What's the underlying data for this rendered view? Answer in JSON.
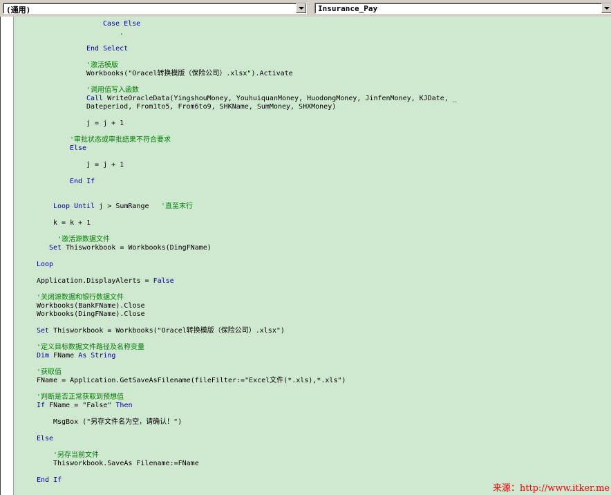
{
  "toolbar": {
    "object_combo": "(通用)",
    "procedure_combo": "Insurance_Pay"
  },
  "code_lines": [
    {
      "text": "Case Else",
      "kind": "keyword"
    },
    {
      "text": "'",
      "kind": "comment"
    },
    {
      "text": "End Select",
      "kind": "keyword"
    },
    {
      "text": "'激活模版",
      "kind": "comment"
    },
    {
      "text": "Workbooks(\"Oracel转换模版（保险公司）.xlsx\").Activate",
      "kind": "plain"
    },
    {
      "text": "'调用值写入函数",
      "kind": "comment"
    },
    {
      "text": "Call WriteOracleData(YingshouMoney, YouhuiquanMoney, HuodongMoney, JinfenMoney, KJDate, _",
      "kind": "call"
    },
    {
      "text": "Dateperiod, From1to5, From6to9, SHKName, SumMoney, SHXMoney)",
      "kind": "plain"
    },
    {
      "text": "j = j + 1",
      "kind": "plain"
    },
    {
      "text": "'审批状态或审批结果不符合要求",
      "kind": "comment"
    },
    {
      "text": "Else",
      "kind": "keyword"
    },
    {
      "text": "j = j + 1",
      "kind": "plain"
    },
    {
      "text": "End If",
      "kind": "keyword"
    },
    {
      "text": "Loop Until j > SumRange",
      "kind": "loop_until"
    },
    {
      "text": "'直至末行",
      "kind": "comment"
    },
    {
      "text": "k = k + 1",
      "kind": "plain"
    },
    {
      "text": "'激活源数据文件",
      "kind": "comment"
    },
    {
      "text": "Set Thisworkbook = Workbooks(DingFName)",
      "kind": "set"
    },
    {
      "text": "Loop",
      "kind": "keyword"
    },
    {
      "text": "Application.DisplayAlerts = False",
      "kind": "false"
    },
    {
      "text": "'关闭源数据和银行数据文件",
      "kind": "comment"
    },
    {
      "text": "Workbooks(BankFName).Close",
      "kind": "plain"
    },
    {
      "text": "Workbooks(DingFName).Close",
      "kind": "plain"
    },
    {
      "text": "Set Thisworkbook = Workbooks(\"Oracel转换模版（保险公司）.xlsx\")",
      "kind": "set"
    },
    {
      "text": "'定义目标数据文件路径及名称变量",
      "kind": "comment"
    },
    {
      "text": "Dim FName As String",
      "kind": "keyword"
    },
    {
      "text": "'获取值",
      "kind": "comment"
    },
    {
      "text": "FName = Application.GetSaveAsFilename(fileFilter:=\"Excel文件(*.xls),*.xls\")",
      "kind": "plain"
    },
    {
      "text": "'判断是否正常获取到预想值",
      "kind": "comment"
    },
    {
      "text": "If FName = \"False\" Then",
      "kind": "if"
    },
    {
      "text": "MsgBox (\"另存文件名为空，请确认！\")",
      "kind": "plain"
    },
    {
      "text": "Else",
      "kind": "keyword"
    },
    {
      "text": "'另存当前文件",
      "kind": "comment"
    },
    {
      "text": "Thisworkbook.SaveAs Filename:=FName",
      "kind": "plain"
    },
    {
      "text": "End If",
      "kind": "keyword"
    }
  ],
  "watermark": "来源：http://www.itker.me",
  "colors": {
    "keyword": "#0000a0",
    "comment": "#008000",
    "editor_bg": "#cfe8d0"
  }
}
